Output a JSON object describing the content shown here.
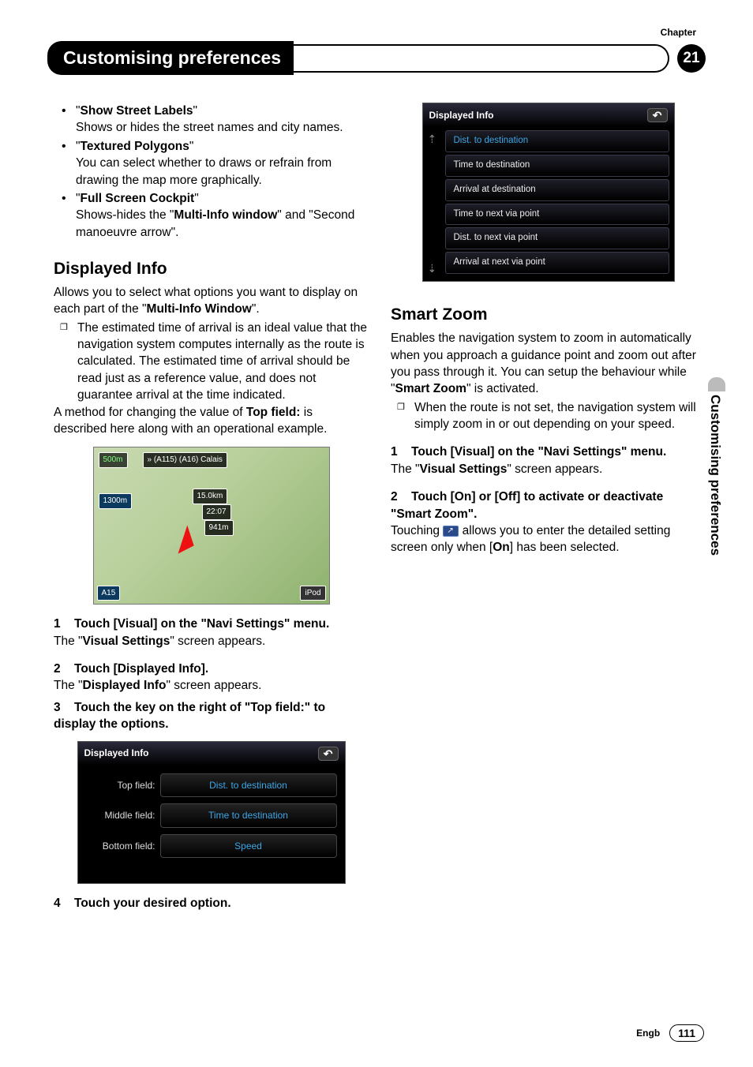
{
  "header": {
    "chapter_label": "Chapter",
    "title": "Customising preferences",
    "chapter_num": "21"
  },
  "bullets": [
    {
      "title": "Show Street Labels",
      "desc": "Shows or hides the street names and city names."
    },
    {
      "title": "Textured Polygons",
      "desc": "You can select whether to draws or refrain from drawing the map more graphically."
    },
    {
      "title": "Full Screen Cockpit",
      "desc_pre": "Shows-hides the \"",
      "desc_bold": "Multi-Info window",
      "desc_post": "\" and \"Second manoeuvre arrow\"."
    }
  ],
  "displayed_info": {
    "heading": "Displayed Info",
    "intro_pre": "Allows you to select what options you want to display on each part of the \"",
    "intro_bold": "Multi-Info Window",
    "intro_post": "\".",
    "note": "The estimated time of arrival is an ideal value that the navigation system computes internally as the route is calculated. The estimated time of arrival should be read just as a reference value, and does not guarantee arrival at the time indicated.",
    "method_pre": "A method for changing the value of ",
    "method_bold": "Top field:",
    "method_post": " is described here along with an operational example."
  },
  "map_overlay": {
    "scale": "500m",
    "route": "» (A115) (A16) Calais",
    "dist1": "1300m",
    "dist2": "15.0km",
    "time": "22:07",
    "alt": "941m",
    "a15": "A15",
    "ipod": "iPod"
  },
  "steps_left": [
    {
      "num": "1",
      "text": "Touch [Visual] on the \"Navi Settings\" menu.",
      "after_pre": "The \"",
      "after_bold": "Visual Settings",
      "after_post": "\" screen appears."
    },
    {
      "num": "2",
      "text": "Touch [Displayed Info].",
      "after_pre": "The \"",
      "after_bold": "Displayed Info",
      "after_post": "\" screen appears."
    }
  ],
  "step3": {
    "num": "3",
    "text": "Touch the key on the right of \"Top field:\" to display the options."
  },
  "screen1": {
    "title": "Displayed Info",
    "rows": [
      {
        "label": "Top field:",
        "value": "Dist. to destination"
      },
      {
        "label": "Middle field:",
        "value": "Time to destination"
      },
      {
        "label": "Bottom field:",
        "value": "Speed"
      }
    ]
  },
  "step4": {
    "num": "4",
    "text": "Touch your desired option."
  },
  "screen2": {
    "title": "Displayed Info",
    "items": [
      "Dist. to destination",
      "Time to destination",
      "Arrival at destination",
      "Time to next via point",
      "Dist. to next via point",
      "Arrival at next via point"
    ]
  },
  "smart_zoom": {
    "heading": "Smart Zoom",
    "intro_pre": "Enables the navigation system to zoom in automatically when you approach a guidance point and zoom out after you pass through it. You can setup the behaviour while \"",
    "intro_bold": "Smart Zoom",
    "intro_post": "\" is activated.",
    "note": "When the route is not set, the navigation system will simply zoom in or out depending on your speed.",
    "step1": {
      "num": "1",
      "text": "Touch [Visual] on the \"Navi Settings\" menu.",
      "after_pre": "The \"",
      "after_bold": "Visual Settings",
      "after_post": "\" screen appears."
    },
    "step2": {
      "num": "2",
      "text": "Touch [On] or [Off] to activate or deactivate \"Smart Zoom\"."
    },
    "touch_pre": "Touching ",
    "touch_post_pre": " allows you to enter the detailed setting screen only when [",
    "touch_bold": "On",
    "touch_post_post": "] has been selected."
  },
  "side_tab": "Customising preferences",
  "footer": {
    "lang": "Engb",
    "page": "111"
  }
}
